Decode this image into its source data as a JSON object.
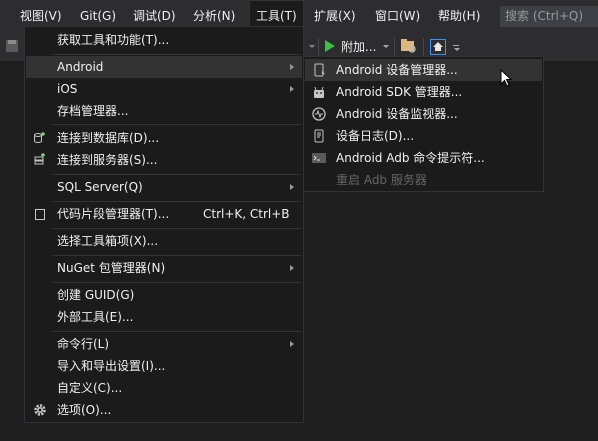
{
  "menubar": {
    "items": [
      "视图(V)",
      "Git(G)",
      "调试(D)",
      "分析(N)",
      "工具(T)",
      "扩展(X)",
      "窗口(W)",
      "帮助(H)"
    ],
    "search_placeholder": "搜索 (Ctrl+Q)"
  },
  "toolbar": {
    "attach_label": "附加...",
    "colors": {
      "play": "#3fbf3f",
      "folder": "#dcb67a",
      "home": "#3794ff"
    }
  },
  "tools_menu": {
    "items": [
      {
        "label": "获取工具和功能(T)...",
        "icon": "",
        "submenu": false
      },
      {
        "label": "Android",
        "icon": "",
        "submenu": true,
        "highlighted": true
      },
      {
        "label": "iOS",
        "icon": "",
        "submenu": true
      },
      {
        "label": "存档管理器...",
        "icon": "",
        "submenu": false
      },
      {
        "label": "连接到数据库(D)...",
        "icon": "database-connect-icon",
        "submenu": false
      },
      {
        "label": "连接到服务器(S)...",
        "icon": "server-connect-icon",
        "submenu": false
      },
      {
        "label": "SQL Server(Q)",
        "icon": "",
        "submenu": true
      },
      {
        "label": "代码片段管理器(T)...",
        "icon": "snippet-icon",
        "shortcut": "Ctrl+K, Ctrl+B",
        "submenu": false
      },
      {
        "label": "选择工具箱项(X)...",
        "icon": "",
        "submenu": false
      },
      {
        "label": "NuGet 包管理器(N)",
        "icon": "",
        "submenu": true
      },
      {
        "label": "创建 GUID(G)",
        "icon": "",
        "submenu": false
      },
      {
        "label": "外部工具(E)...",
        "icon": "",
        "submenu": false
      },
      {
        "label": "命令行(L)",
        "icon": "",
        "submenu": true
      },
      {
        "label": "导入和导出设置(I)...",
        "icon": "",
        "submenu": false
      },
      {
        "label": "自定义(C)...",
        "icon": "",
        "submenu": false
      },
      {
        "label": "选项(O)...",
        "icon": "gear-icon",
        "submenu": false
      }
    ]
  },
  "android_submenu": {
    "items": [
      {
        "label": "Android 设备管理器...",
        "icon": "device-manager-icon",
        "highlighted": true
      },
      {
        "label": "Android SDK 管理器...",
        "icon": "sdk-manager-icon"
      },
      {
        "label": "Android 设备监视器...",
        "icon": "device-monitor-icon"
      },
      {
        "label": "设备日志(D)...",
        "icon": "device-log-icon"
      },
      {
        "label": "Android Adb 命令提示符...",
        "icon": "terminal-icon"
      },
      {
        "label": "重启 Adb 服务器",
        "icon": "",
        "disabled": true
      }
    ]
  }
}
